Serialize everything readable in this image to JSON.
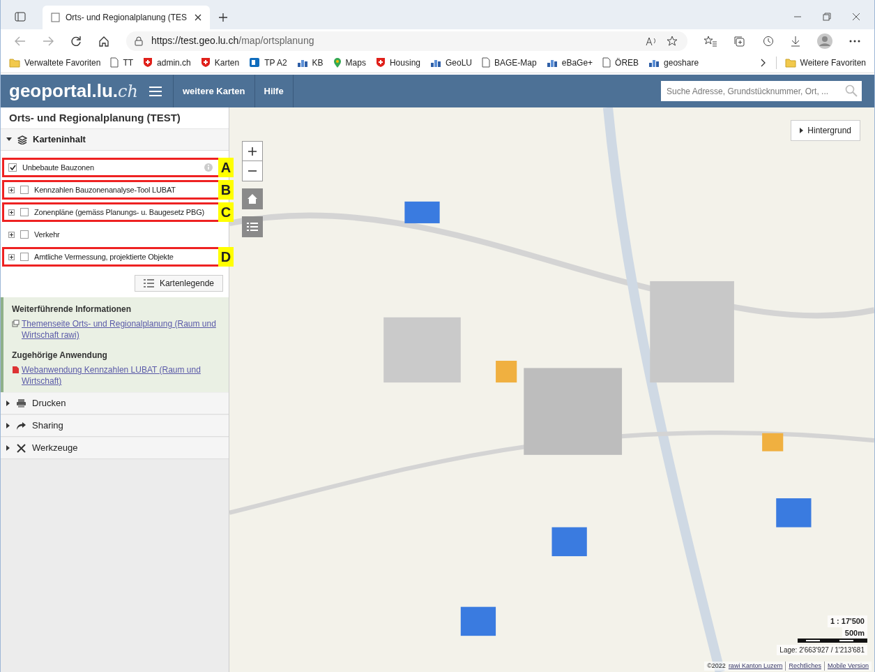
{
  "browser": {
    "tab_title": "Orts- und Regionalplanung (TES",
    "url_host": "https://test.geo.lu.ch",
    "url_path": "/map/ortsplanung",
    "favorites": [
      {
        "label": "Verwaltete Favoriten",
        "kind": "folder"
      },
      {
        "label": "TT",
        "kind": "page"
      },
      {
        "label": "admin.ch",
        "kind": "shield"
      },
      {
        "label": "Karten",
        "kind": "shield"
      },
      {
        "label": "TP A2",
        "kind": "app"
      },
      {
        "label": "KB",
        "kind": "chart"
      },
      {
        "label": "Maps",
        "kind": "pin"
      },
      {
        "label": "Housing",
        "kind": "shield"
      },
      {
        "label": "GeoLU",
        "kind": "chart"
      },
      {
        "label": "BAGE-Map",
        "kind": "page"
      },
      {
        "label": "eBaGe+",
        "kind": "chart"
      },
      {
        "label": "ÖREB",
        "kind": "page"
      },
      {
        "label": "geoshare",
        "kind": "chart"
      }
    ],
    "other_favorites": "Weitere Favoriten"
  },
  "header": {
    "logo": "geoportal.lu.",
    "logo_suffix": "ch",
    "nav": [
      "weitere Karten",
      "Hilfe"
    ],
    "search": {
      "placeholder": "Suche Adresse, Grundstücknummer, Ort, ..."
    }
  },
  "panel": {
    "title": "Orts- und Regionalplanung (TEST)",
    "content_section": {
      "label": "Karteninhalt",
      "expanded": true
    },
    "layers": [
      {
        "label": "Unbebaute Bauzonen",
        "checked": true,
        "expandable": false,
        "info": true,
        "annotation": "A"
      },
      {
        "label": "Kennzahlen Bauzonenanalyse-Tool LUBAT",
        "checked": false,
        "expandable": true,
        "info": false,
        "annotation": "B"
      },
      {
        "label": "Zonenpläne (gemäss Planungs- u. Baugesetz PBG)",
        "checked": false,
        "expandable": true,
        "info": false,
        "annotation": "C"
      },
      {
        "label": "Verkehr",
        "checked": false,
        "expandable": true,
        "info": false
      },
      {
        "label": "Amtliche Vermessung, projektierte Objekte",
        "checked": false,
        "expandable": true,
        "info": false,
        "annotation": "D"
      }
    ],
    "legend_button": "Kartenlegende",
    "info_blocks": [
      {
        "heading": "Weiterführende Informationen",
        "link": "Themenseite Orts- und Regionalplanung (Raum und Wirtschaft rawi)",
        "kind": "external"
      },
      {
        "heading": "Zugehörige Anwendung",
        "link": "Webanwendung Kennzahlen LUBAT (Raum und Wirtschaft)",
        "kind": "pdf"
      }
    ],
    "sections": [
      {
        "label": "Drucken",
        "kind": "print",
        "expanded": false
      },
      {
        "label": "Sharing",
        "kind": "share",
        "expanded": false
      },
      {
        "label": "Werkzeuge",
        "kind": "tools",
        "expanded": false
      }
    ]
  },
  "map": {
    "background_button": "Hintergrund",
    "scale": "1 : 17'500",
    "scale_bar_label": "500m",
    "position": "Lage: 2'663'927 / 1'213'681",
    "copyright": "©2022",
    "links": [
      "rawi Kanton Luzern",
      "Rechtliches",
      "Mobile Version"
    ]
  }
}
